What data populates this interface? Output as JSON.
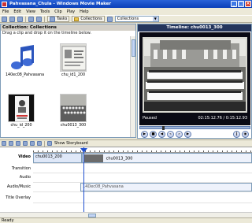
{
  "window": {
    "title": "Pahvasana_Chula - Windows Movie Maker"
  },
  "menu": [
    "File",
    "Edit",
    "View",
    "Tools",
    "Clip",
    "Play",
    "Help"
  ],
  "toolbar": {
    "tasks_label": "Tasks",
    "collections_label": "Collections",
    "collections_select": "Collections"
  },
  "collections": {
    "header": "Collection: Collections",
    "hint": "Drag a clip and drop it on the timeline below.",
    "items": [
      {
        "label": "140ec08_Pahvasana",
        "kind": "audio"
      },
      {
        "label": "chu_id1_200",
        "kind": "id-card"
      },
      {
        "label": "chu_id_200",
        "kind": "portrait"
      },
      {
        "label": "chu0013_300",
        "kind": "group-photo"
      }
    ]
  },
  "preview": {
    "title": "Timeline: chu0013_300",
    "status": "Paused",
    "time": "02:15:12.76 / 0:15:12.93"
  },
  "timeline": {
    "show_storyboard_label": "Show Storyboard",
    "tracks": [
      {
        "label": "Video"
      },
      {
        "label": "Transition"
      },
      {
        "label": "Audio"
      },
      {
        "label": "Audio/Music"
      },
      {
        "label": "Title Overlay"
      }
    ],
    "video_clips": [
      "chu0013_200",
      "chu0013_300"
    ],
    "audio_clip": "14Dec08_Pahvasana"
  },
  "statusbar": {
    "text": "Ready"
  },
  "colors": {
    "title_bar": "#0a3fb8",
    "preview_header": "#24355c",
    "playhead": "#2050d0"
  }
}
